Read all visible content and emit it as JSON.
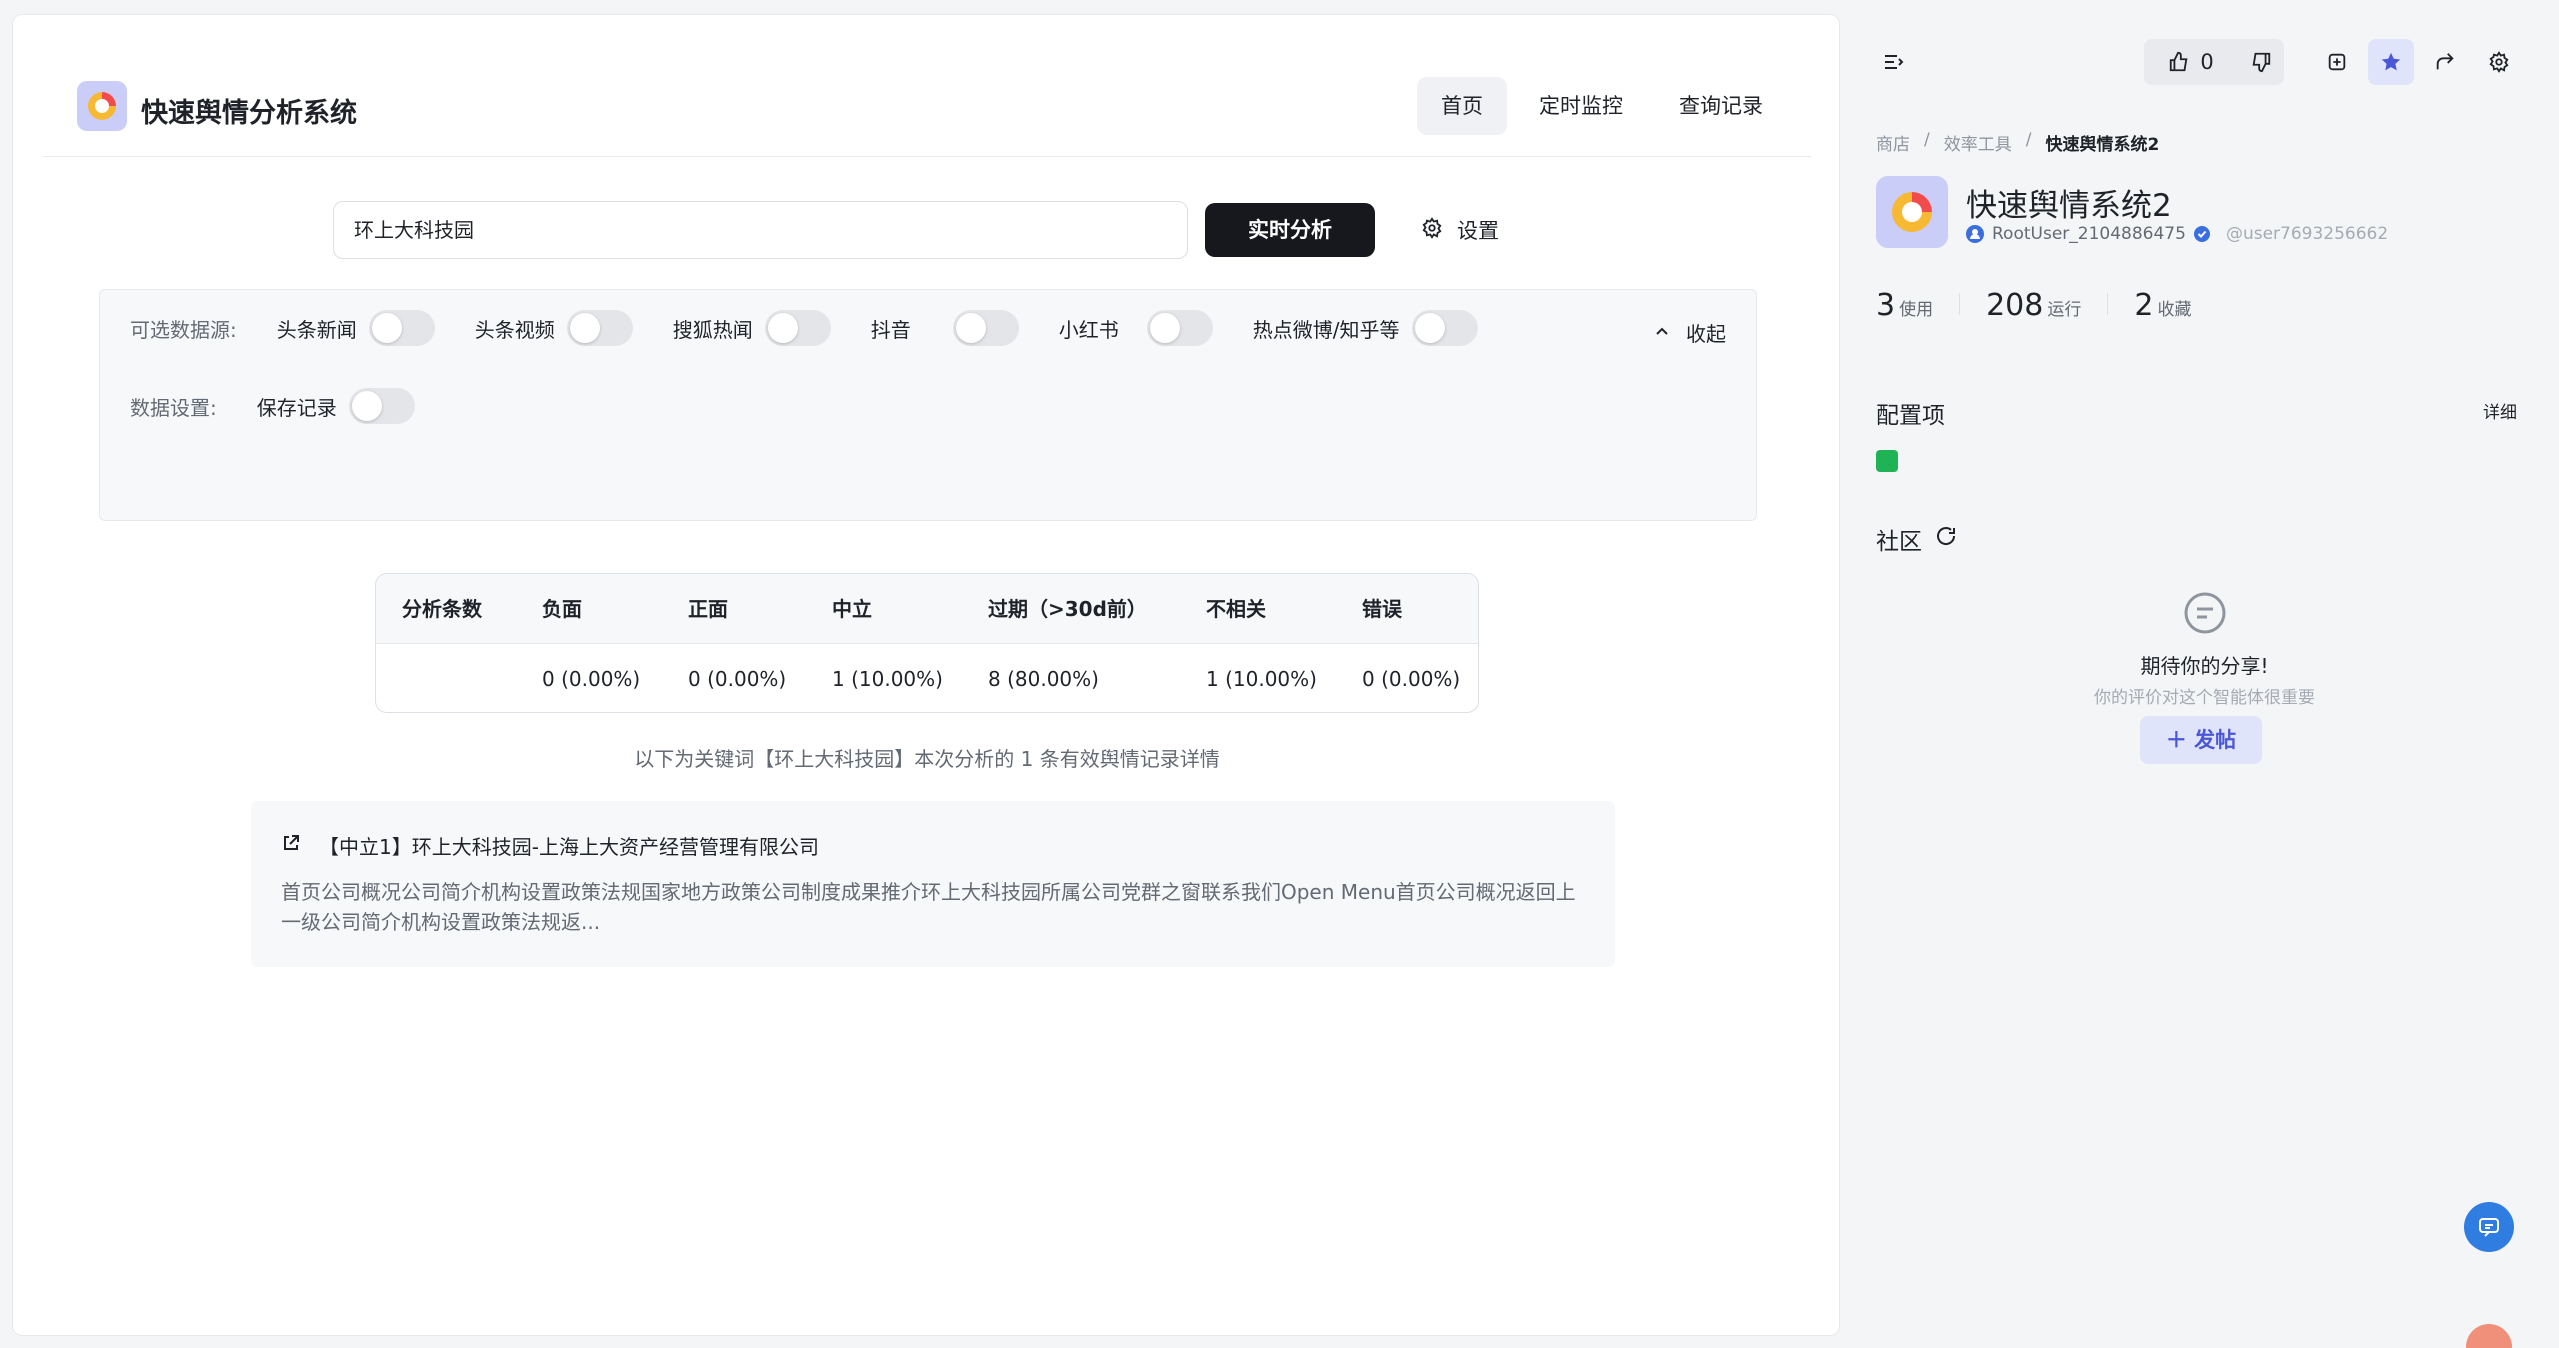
{
  "app": {
    "title": "快速舆情分析系统",
    "nav": [
      "首页",
      "定时监控",
      "查询记录"
    ],
    "active_nav": "首页"
  },
  "search": {
    "value": "环上大科技园",
    "analyze_label": "实时分析",
    "settings_label": "设置"
  },
  "options": {
    "sources_label": "可选数据源:",
    "sources": [
      "头条新闻",
      "头条视频",
      "搜狐热闻",
      "抖音",
      "小红书",
      "热点微博/知乎等"
    ],
    "data_settings_label": "数据设置:",
    "save_records_label": "保存记录",
    "collapse_label": "收起"
  },
  "stats": {
    "headers": [
      "分析条数",
      "负面",
      "正面",
      "中立",
      "过期（>30d前）",
      "不相关",
      "错误"
    ],
    "values": [
      "",
      "0 (0.00%)",
      "0 (0.00%)",
      "1 (10.00%)",
      "8 (80.00%)",
      "1 (10.00%)",
      "0 (0.00%)"
    ]
  },
  "summary": "以下为关键词【环上大科技园】本次分析的 1 条有效舆情记录详情",
  "record": {
    "title": "【中立1】环上大科技园-上海上大资产经营管理有限公司",
    "body": "首页公司概况公司简介机构设置政策法规国家地方政策公司制度成果推介环上大科技园所属公司党群之窗联系我们Open Menu首页公司概况返回上一级公司简介机构设置政策法规返..."
  },
  "sidebar": {
    "like_count": "0",
    "breadcrumb": [
      "商店",
      "效率工具",
      "快速舆情系统2"
    ],
    "agent_name": "快速舆情系统2",
    "owner": "RootUser_2104886475",
    "handle": "@user7693256662",
    "stats": [
      {
        "value": "3",
        "label": "使用"
      },
      {
        "value": "208",
        "label": "运行"
      },
      {
        "value": "2",
        "label": "收藏"
      }
    ],
    "config_title": "配置项",
    "config_detail": "详细",
    "community_title": "社区",
    "empty_title": "期待你的分享!",
    "empty_sub": "你的评价对这个智能体很重要",
    "post_label": "发帖"
  },
  "colors": {
    "primary_dark": "#16181d",
    "accent_blue": "#4a56d6",
    "fab_blue": "#2f7de1",
    "star_active": "#4a56d6"
  }
}
